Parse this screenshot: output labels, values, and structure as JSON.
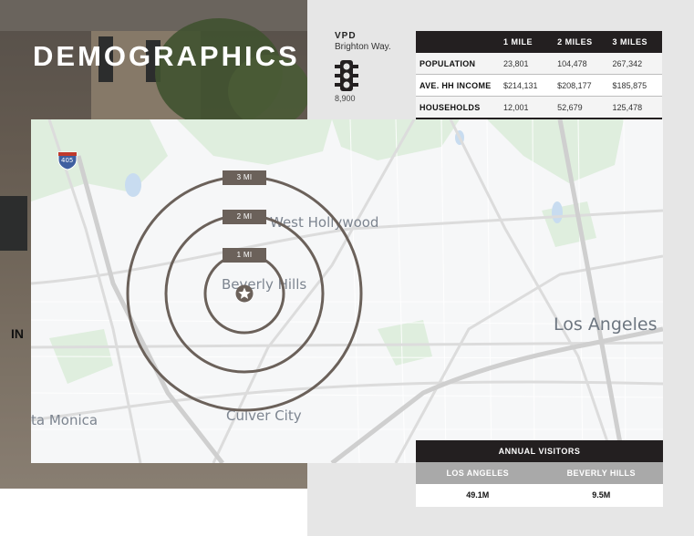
{
  "header": {
    "title": "DEMOGRAPHICS"
  },
  "vpd": {
    "label": "VPD",
    "street": "Brighton Way.",
    "icon": "traffic-light-icon",
    "value": "8,900"
  },
  "demographics": {
    "columns": [
      "",
      "1 MILE",
      "2 MILES",
      "3 MILES"
    ],
    "rows": [
      {
        "label": "POPULATION",
        "values": [
          "23,801",
          "104,478",
          "267,342"
        ]
      },
      {
        "label": "AVE. HH INCOME",
        "values": [
          "$214,131",
          "$208,177",
          "$185,875"
        ]
      },
      {
        "label": "HOUSEHOLDS",
        "values": [
          "12,001",
          "52,679",
          "125,478"
        ]
      }
    ]
  },
  "map": {
    "labels": {
      "west_hollywood": "West Hollywood",
      "beverly_hills": "Beverly Hills",
      "los_angeles": "Los Angeles",
      "santa_monica": "ta Monica",
      "culver_city": "Culver City"
    },
    "highway_shield": "405",
    "radii": [
      "3 MI",
      "2 MI",
      "1 MI"
    ],
    "center_icon": "star-icon"
  },
  "visitors": {
    "title": "ANNUAL VISITORS",
    "columns": [
      "LOS ANGELES",
      "BEVERLY HILLS"
    ],
    "values": [
      "49.1M",
      "9.5M"
    ]
  },
  "colors": {
    "dark": "#231f20",
    "ring": "#6b615a",
    "grey_header": "#a9a9a9"
  }
}
